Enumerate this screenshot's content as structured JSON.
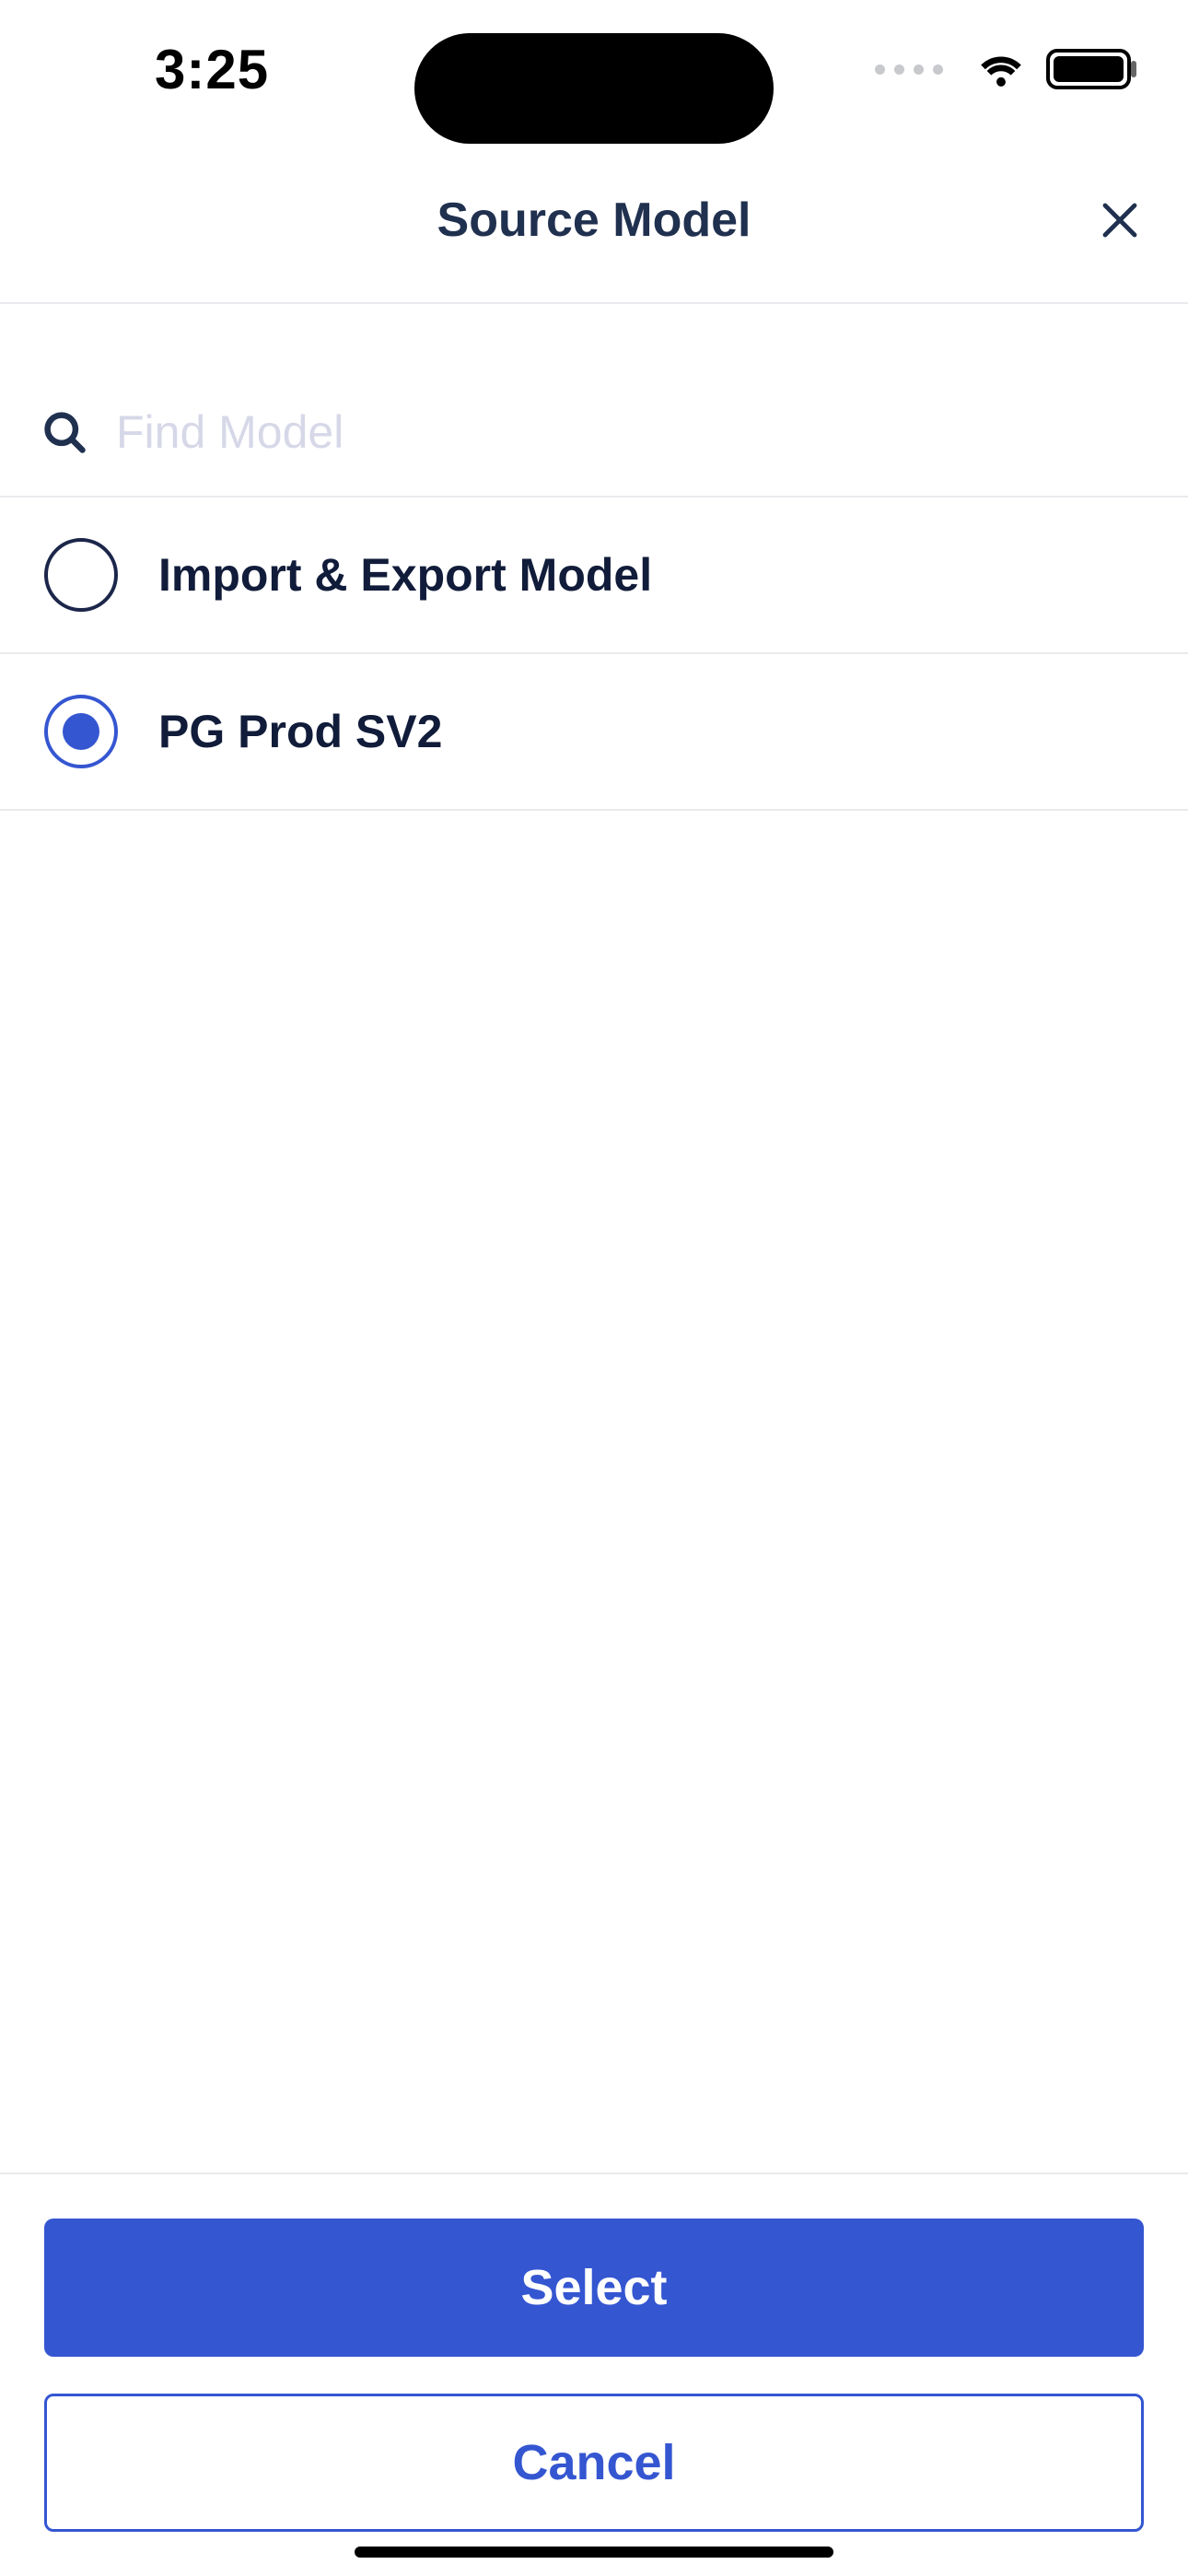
{
  "status": {
    "time": "3:25"
  },
  "nav": {
    "title": "Source Model"
  },
  "search": {
    "placeholder": "Find Model",
    "value": ""
  },
  "rows": [
    {
      "label": "Import & Export Model",
      "selected": false
    },
    {
      "label": "PG Prod SV2",
      "selected": true
    }
  ],
  "footer": {
    "primary": "Select",
    "secondary": "Cancel"
  },
  "colors": {
    "accent": "#3556d1",
    "text": "#1b264a",
    "border": "#e9eaed"
  }
}
